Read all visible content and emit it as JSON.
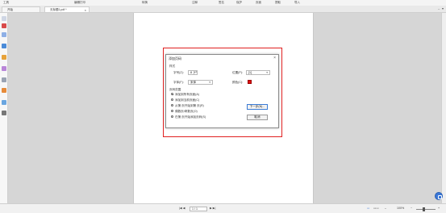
{
  "menubar": {
    "items": [
      "工具",
      "编辑打印",
      "转换",
      "注释",
      "签名",
      "保护",
      "页面",
      "提取",
      "导入"
    ]
  },
  "tabs": {
    "home": "开始",
    "document": "无标题1.pdf *",
    "close_glyph": "×"
  },
  "dialog": {
    "title": "添加页码",
    "close": "×",
    "section_style": "样式",
    "label_font_size": "字号(Z):",
    "font_size_value": "8",
    "label_font": "字体(F):",
    "font_value": "宋体",
    "label_position": "位置(P):",
    "position_value": "[1]",
    "label_color": "颜色(C):",
    "color_value": "#e01010",
    "section_range": "页码范围",
    "range_options": [
      {
        "label": "添加到所有页面(A)",
        "selected": true
      },
      {
        "label": "添加到当前页面(C)",
        "selected": false
      },
      {
        "label": "从第 页开始到第 页(R)",
        "selected": false
      },
      {
        "label": "偶数页/奇数页(O)",
        "selected": false
      },
      {
        "label": "在第 页开始添加页码(S)",
        "selected": false
      }
    ],
    "btn_next": "下一步(N)...",
    "btn_cancel": "取消"
  },
  "statusbar": {
    "nav_left": "|◀ ◀",
    "page_value": "1 / 1",
    "nav_right": "▶ ▶|",
    "zoom": "100%",
    "zoom_minus": "−",
    "zoom_plus": "+"
  },
  "colors": {
    "highlight": "#e02020",
    "accent": "#3b78d8"
  }
}
